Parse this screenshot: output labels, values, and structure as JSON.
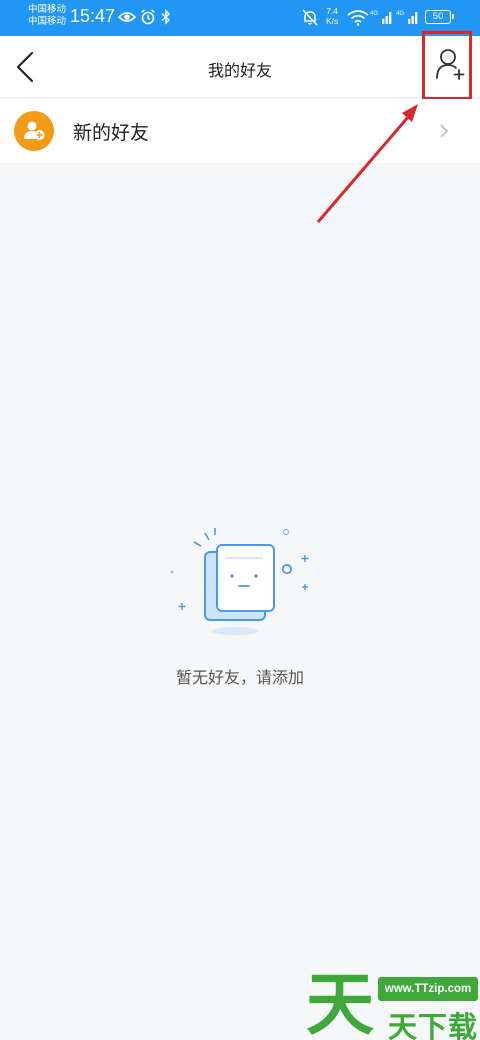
{
  "status_bar": {
    "carrier1": "中国移动",
    "carrier2": "中国移动",
    "time": "15:47",
    "net_speed_value": "7.4",
    "net_speed_unit": "K/s",
    "signal1_label": "4G",
    "signal2_label": "4G",
    "battery": "50",
    "icons": [
      "eye-icon",
      "alarm-icon",
      "bluetooth-icon",
      "mute-icon",
      "wifi-icon",
      "signal-icon",
      "battery-icon"
    ]
  },
  "nav": {
    "title": "我的好友",
    "back_icon": "chevron-left-icon",
    "add_icon": "add-friend-icon"
  },
  "new_friends": {
    "label": "新的好友",
    "icon": "new-friend-icon",
    "icon_color": "#f29b17"
  },
  "empty_state": {
    "text": "暂无好友，请添加",
    "icon": "empty-list-illustration"
  },
  "watermark": {
    "url": "www.TTzip.com",
    "text": "天下载",
    "logo_char": "天"
  },
  "colors": {
    "status_bar": "#2196f3",
    "highlight": "#d9272e",
    "watermark": "#3fa83a",
    "background": "#f6f7f9"
  }
}
